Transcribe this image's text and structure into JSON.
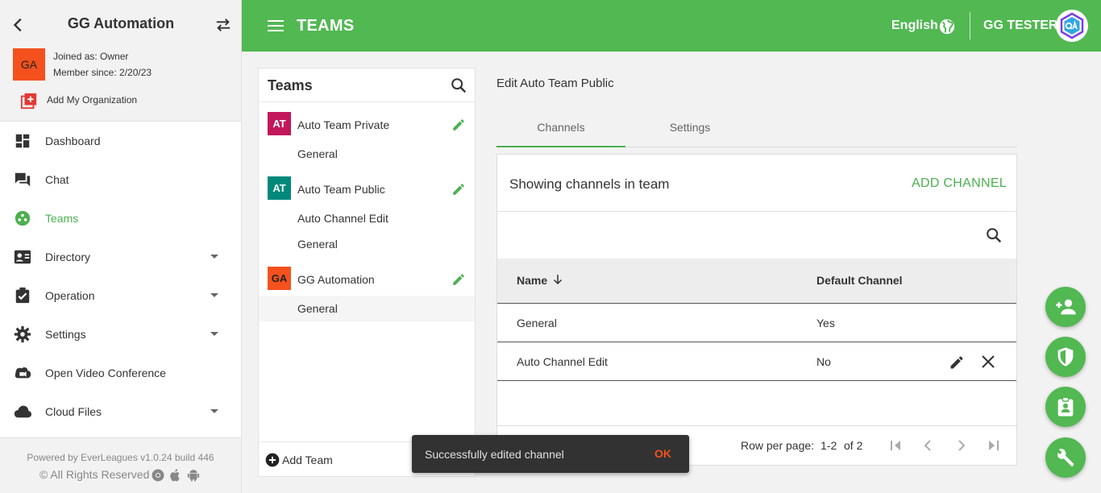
{
  "sidebar": {
    "title": "GG Automation",
    "org_avatar": "GA",
    "joined": "Joined as: Owner",
    "member_since": "Member since: 2/20/23",
    "add_org": "Add My Organization",
    "nav": [
      {
        "label": "Dashboard",
        "icon": "dashboard-icon"
      },
      {
        "label": "Chat",
        "icon": "chat-icon"
      },
      {
        "label": "Teams",
        "icon": "teams-icon",
        "active": true
      },
      {
        "label": "Directory",
        "icon": "directory-icon",
        "expandable": true
      },
      {
        "label": "Operation",
        "icon": "operation-icon",
        "expandable": true
      },
      {
        "label": "Settings",
        "icon": "gear-icon",
        "expandable": true
      },
      {
        "label": "Open Video Conference",
        "icon": "video-conference-icon"
      },
      {
        "label": "Cloud Files",
        "icon": "cloud-icon",
        "expandable": true
      }
    ],
    "powered_by": "Powered by EverLeagues v1.0.24 build 446",
    "rights": "© All Rights Reserved"
  },
  "header": {
    "title": "TEAMS",
    "language": "English",
    "user": "GG TESTER",
    "accent_color": "#52b852"
  },
  "teams_panel": {
    "title": "Teams",
    "add_team": "Add Team",
    "teams": [
      {
        "badge": "AT",
        "badge_color": "#c2185b",
        "name": "Auto Team Private",
        "channels": [
          "General"
        ]
      },
      {
        "badge": "AT",
        "badge_color": "#00897b",
        "name": "Auto Team Public",
        "channels": [
          "Auto Channel Edit",
          "General"
        ]
      },
      {
        "badge": "GA",
        "badge_color": "#f4511e",
        "name": "GG Automation",
        "channels": [
          "General"
        ]
      }
    ]
  },
  "main": {
    "edit_title": "Edit Auto Team Public",
    "tabs": [
      "Channels",
      "Settings"
    ],
    "card_title": "Showing channels in team",
    "add_channel": "ADD CHANNEL",
    "columns": [
      "Name",
      "Default Channel"
    ],
    "rows": [
      {
        "name": "General",
        "default": "Yes"
      },
      {
        "name": "Auto Channel Edit",
        "default": "No"
      }
    ],
    "rows_per_page_label": "Row per page:",
    "range": "1-2",
    "of": "of 2"
  },
  "snackbar": {
    "message": "Successfully edited channel",
    "action": "OK"
  }
}
